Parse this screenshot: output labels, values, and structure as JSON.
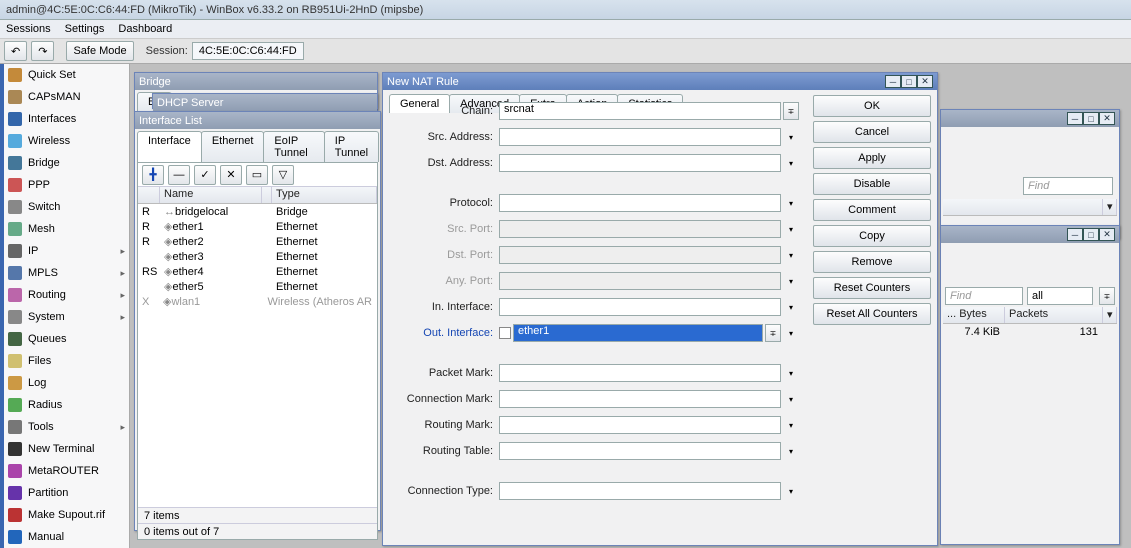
{
  "title": "admin@4C:5E:0C:C6:44:FD (MikroTik) - WinBox v6.33.2 on RB951Ui-2HnD (mipsbe)",
  "menus": [
    "Sessions",
    "Settings",
    "Dashboard"
  ],
  "toolbar": {
    "undo_icon": "↶",
    "redo_icon": "↷",
    "safe_mode": "Safe Mode",
    "session_label": "Session:",
    "session_value": "4C:5E:0C:C6:44:FD"
  },
  "sidebar": [
    {
      "label": "Quick Set",
      "icon": "#c48a3a"
    },
    {
      "label": "CAPsMAN",
      "icon": "#aa8855"
    },
    {
      "label": "Interfaces",
      "icon": "#3366aa"
    },
    {
      "label": "Wireless",
      "icon": "#55aadd"
    },
    {
      "label": "Bridge",
      "icon": "#447799"
    },
    {
      "label": "PPP",
      "icon": "#cc5555"
    },
    {
      "label": "Switch",
      "icon": "#888888"
    },
    {
      "label": "Mesh",
      "icon": "#66aa88"
    },
    {
      "label": "IP",
      "icon": "#666",
      "chev": true
    },
    {
      "label": "MPLS",
      "icon": "#5577aa",
      "chev": true
    },
    {
      "label": "Routing",
      "icon": "#bb66aa",
      "chev": true
    },
    {
      "label": "System",
      "icon": "#888",
      "chev": true
    },
    {
      "label": "Queues",
      "icon": "#446644"
    },
    {
      "label": "Files",
      "icon": "#d0c070"
    },
    {
      "label": "Log",
      "icon": "#cc9944"
    },
    {
      "label": "Radius",
      "icon": "#55aa55"
    },
    {
      "label": "Tools",
      "icon": "#777",
      "chev": true
    },
    {
      "label": "New Terminal",
      "icon": "#333"
    },
    {
      "label": "MetaROUTER",
      "icon": "#aa44aa"
    },
    {
      "label": "Partition",
      "icon": "#6633aa"
    },
    {
      "label": "Make Supout.rif",
      "icon": "#bb3333"
    },
    {
      "label": "Manual",
      "icon": "#2266bb"
    }
  ],
  "bridge_win": {
    "title": "Bridge",
    "subtab": "Bri"
  },
  "dhcp_win": {
    "title": "DHCP Server"
  },
  "iflist_win": {
    "title": "Interface List",
    "tabs": [
      "Interface",
      "Ethernet",
      "EoIP Tunnel",
      "IP Tunnel"
    ],
    "active_tab": 0,
    "toolbtns": {
      "add": "╋",
      "remove": "—",
      "enable": "✓",
      "disable": "✕",
      "comment": "▭",
      "filter": "▽"
    },
    "cols": [
      "",
      "Name",
      "",
      "Type"
    ],
    "rows": [
      {
        "flag": "R",
        "name": "bridgelocal",
        "type": "Bridge",
        "icon": "↔"
      },
      {
        "flag": "R",
        "name": "ether1",
        "type": "Ethernet",
        "icon": "◈"
      },
      {
        "flag": "R",
        "name": "ether2",
        "type": "Ethernet",
        "icon": "◈"
      },
      {
        "flag": "",
        "name": "ether3",
        "type": "Ethernet",
        "icon": "◈"
      },
      {
        "flag": "RS",
        "name": "ether4",
        "type": "Ethernet",
        "icon": "◈"
      },
      {
        "flag": "",
        "name": "ether5",
        "type": "Ethernet",
        "icon": "◈"
      },
      {
        "flag": "X",
        "name": "wlan1",
        "type": "Wireless (Atheros AR",
        "icon": "◈",
        "disabled": true
      }
    ],
    "status1": "7 items",
    "status2": "0 items out of 7"
  },
  "nat_win": {
    "title": "New NAT Rule",
    "tabs": [
      "General",
      "Advanced",
      "Extra",
      "Action",
      "Statistics"
    ],
    "active_tab": 0,
    "buttons": [
      "OK",
      "Cancel",
      "Apply",
      "Disable",
      "Comment",
      "Copy",
      "Remove",
      "Reset Counters",
      "Reset All Counters"
    ],
    "fields": [
      {
        "label": "Chain:",
        "value": "srcnat",
        "dd": true,
        "group": 0
      },
      {
        "label": "Src. Address:",
        "value": "",
        "toggle": true,
        "group": 0
      },
      {
        "label": "Dst. Address:",
        "value": "",
        "toggle": true,
        "group": 0
      },
      {
        "label": "Protocol:",
        "value": "",
        "toggle": true,
        "group": 1
      },
      {
        "label": "Src. Port:",
        "value": "",
        "toggle": true,
        "dim": true,
        "group": 1
      },
      {
        "label": "Dst. Port:",
        "value": "",
        "toggle": true,
        "dim": true,
        "group": 1
      },
      {
        "label": "Any. Port:",
        "value": "",
        "toggle": true,
        "dim": true,
        "group": 1
      },
      {
        "label": "In. Interface:",
        "value": "",
        "toggle": true,
        "group": 1
      },
      {
        "label": "Out. Interface:",
        "value": "ether1",
        "toggle": true,
        "dd": true,
        "blue": true,
        "checkbox": true,
        "selected": true,
        "group": 1
      },
      {
        "label": "Packet Mark:",
        "value": "",
        "toggle": true,
        "group": 2
      },
      {
        "label": "Connection Mark:",
        "value": "",
        "toggle": true,
        "group": 2
      },
      {
        "label": "Routing Mark:",
        "value": "",
        "toggle": true,
        "group": 2
      },
      {
        "label": "Routing Table:",
        "value": "",
        "toggle": true,
        "group": 2
      },
      {
        "label": "Connection Type:",
        "value": "",
        "toggle": true,
        "group": 3
      }
    ]
  },
  "bgwin1": {
    "find": "Find"
  },
  "bgwin2": {
    "find": "Find",
    "all": "all",
    "cols": [
      "... Bytes",
      "Packets"
    ],
    "row": {
      "bytes": "7.4 KiB",
      "packets": "131"
    }
  }
}
